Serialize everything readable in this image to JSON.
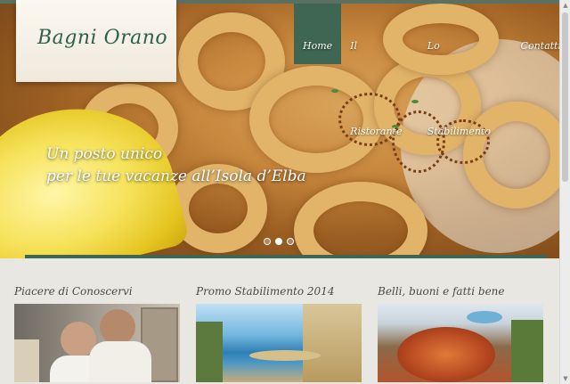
{
  "brand": {
    "name": "Bagni Orano"
  },
  "nav": {
    "items": [
      {
        "label": "Home",
        "active": true
      },
      {
        "label": "Il Ristorante",
        "active": false
      },
      {
        "label": "Lo Stabilimento",
        "active": false
      },
      {
        "label": "Contatti",
        "active": false
      }
    ]
  },
  "hero": {
    "line1": "Un posto unico",
    "line2": "per le tue vacanze all’Isola d’Elba",
    "slides": 3,
    "active_slide": 1
  },
  "sections": [
    {
      "title": "Piacere di Conoscervi"
    },
    {
      "title": "Promo Stabilimento 2014"
    },
    {
      "title": "Belli, buoni e fatti bene"
    }
  ],
  "colors": {
    "accent": "#3e6653",
    "logo": "#2f6148",
    "background": "#e9e7e1"
  }
}
